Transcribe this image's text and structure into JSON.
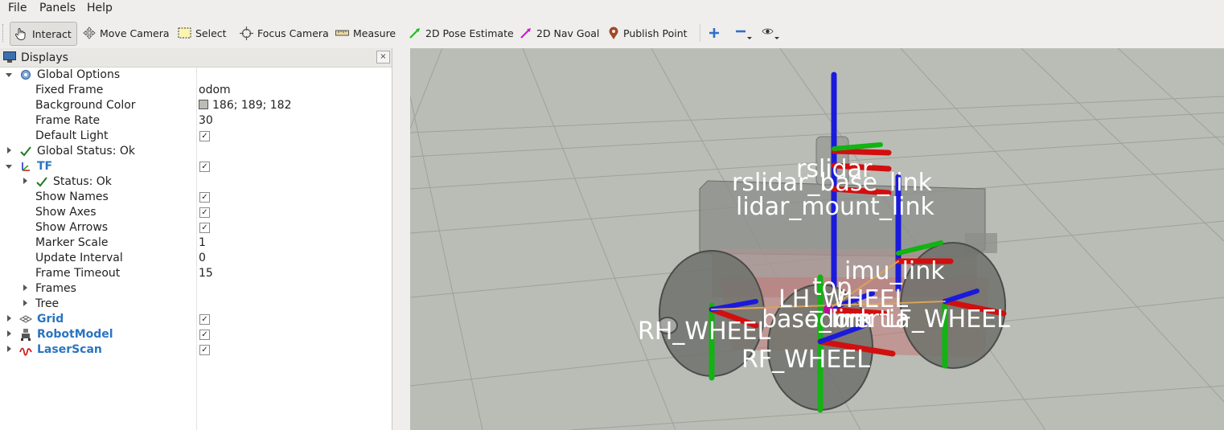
{
  "menubar": {
    "file": "File",
    "panels": "Panels",
    "help": "Help"
  },
  "toolbar": {
    "interact": "Interact",
    "move_camera": "Move Camera",
    "select": "Select",
    "focus_camera": "Focus Camera",
    "measure": "Measure",
    "pose_estimate": "2D Pose Estimate",
    "nav_goal": "2D Nav Goal",
    "publish_point": "Publish Point"
  },
  "displays": {
    "title": "Displays",
    "close": "×",
    "global_options": "Global Options",
    "fixed_frame_label": "Fixed Frame",
    "fixed_frame_value": "odom",
    "bg_color_label": "Background Color",
    "bg_color_value": "186; 189; 182",
    "bg_color_hex": "#babdb6",
    "frame_rate_label": "Frame Rate",
    "frame_rate_value": "30",
    "default_light_label": "Default Light",
    "global_status": "Global Status: Ok",
    "tf": "TF",
    "tf_status": "Status: Ok",
    "show_names": "Show Names",
    "show_axes": "Show Axes",
    "show_arrows": "Show Arrows",
    "marker_scale_label": "Marker Scale",
    "marker_scale_value": "1",
    "update_interval_label": "Update Interval",
    "update_interval_value": "0",
    "frame_timeout_label": "Frame Timeout",
    "frame_timeout_value": "15",
    "frames": "Frames",
    "tree": "Tree",
    "grid": "Grid",
    "robot_model": "RobotModel",
    "laser_scan": "LaserScan",
    "check": "✓"
  },
  "viewport": {
    "frame_labels": {
      "rslidar": "rslidar",
      "rslidar_base_link": "rslidar_base_link",
      "lidar_mount_link": "lidar_mount_link",
      "imu_link": "imu_link",
      "top": "top",
      "lh_wheel": "LH_WHEEL",
      "base_link": "base_link",
      "odom": "odom",
      "inertia": "inertia",
      "rh_wheel": "RH_WHEEL",
      "lf_wheel": "LF_WHEEL",
      "rf_wheel": "RF_WHEEL"
    }
  },
  "colors": {
    "accent_blue": "#2a74c0",
    "axis_x": "#d10f0f",
    "axis_y": "#12b312",
    "axis_z": "#1a1adc"
  }
}
